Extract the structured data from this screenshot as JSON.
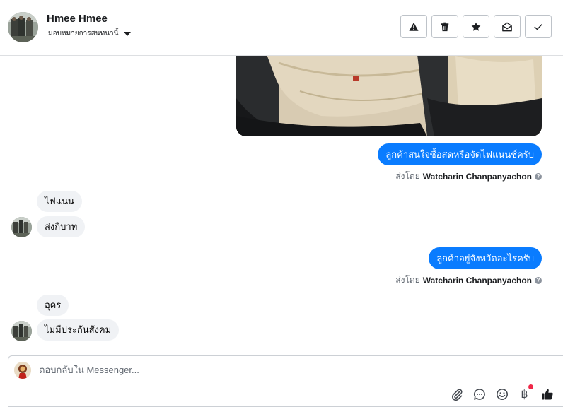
{
  "header": {
    "name": "Hmee Hmee",
    "assign_label": "มอบหมายการสนทนานี้",
    "actions": [
      "warning-icon",
      "trash-icon",
      "star-icon",
      "mail-open-icon",
      "check-icon"
    ]
  },
  "messages": {
    "out_1": "ลูกค้าสนใจซื้อสดหรือจัดไฟแนนซ์ครับ",
    "sent_by_prefix_1": "ส่งโดย",
    "sent_by_name_1": "Watcharin Chanpanyachon",
    "in_1": "ไฟแนน",
    "in_2": "ส่งกี่บาท",
    "out_2": "ลูกค้าอยู่จังหวัดอะไรครับ",
    "sent_by_prefix_2": "ส่งโดย",
    "sent_by_name_2": "Watcharin Chanpanyachon",
    "in_3": "อุดร",
    "in_4": "ไม่มีประกันสังคม"
  },
  "composer": {
    "placeholder": "ตอบกลับใน Messenger...",
    "tools": [
      "paperclip-icon",
      "chat-bubble-icon",
      "emoji-icon",
      "baht-icon",
      "thumbs-up-icon"
    ],
    "baht_symbol": "฿"
  },
  "colors": {
    "outgoing_bubble": "#0a7cff",
    "incoming_bubble": "#f0f2f5",
    "notification_dot": "#f02849"
  }
}
